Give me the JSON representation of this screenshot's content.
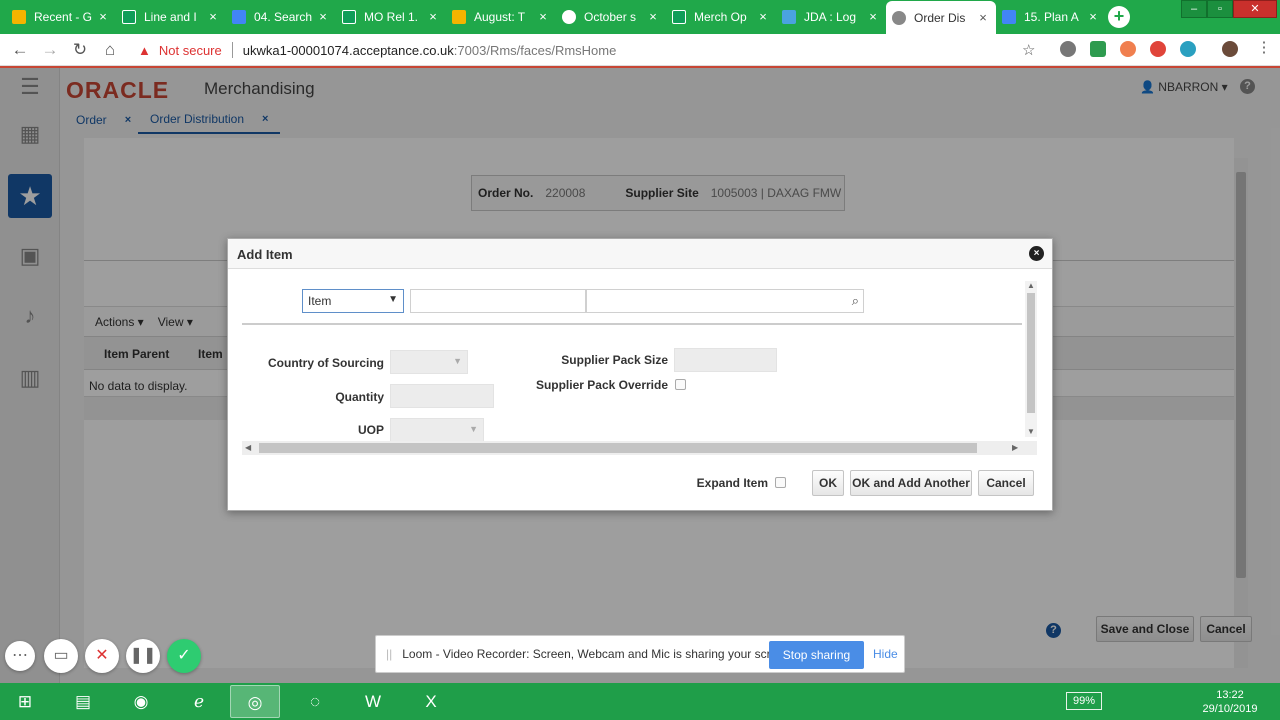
{
  "browser": {
    "tabs": [
      {
        "label": "Recent - G",
        "icon": "google-drive-icon",
        "color": "#f4b400"
      },
      {
        "label": "Line and I",
        "icon": "sheets-icon",
        "color": "#0f9d58"
      },
      {
        "label": "04. Search",
        "icon": "docs-icon",
        "color": "#4285f4"
      },
      {
        "label": "MO Rel 1.",
        "icon": "sheets-icon",
        "color": "#0f9d58"
      },
      {
        "label": "August: T",
        "icon": "slides-icon",
        "color": "#f4b400"
      },
      {
        "label": "October s",
        "icon": "globe-icon",
        "color": "#ffffff"
      },
      {
        "label": "Merch Op",
        "icon": "sheets-icon",
        "color": "#0f9d58"
      },
      {
        "label": "JDA : Log",
        "icon": "jda-icon",
        "color": "#4aa3df"
      },
      {
        "label": "Order Dis",
        "icon": "globe-icon",
        "color": "#888888"
      },
      {
        "label": "15. Plan A",
        "icon": "docs-icon",
        "color": "#4285f4"
      }
    ],
    "active_tab_index": 8,
    "not_secure": "Not secure",
    "url_host": "ukwka1-00001074.acceptance.co.uk",
    "url_path": ":7003/Rms/faces/RmsHome"
  },
  "app": {
    "logo": "ORACLE",
    "title": "Merchandising",
    "user": "NBARRON",
    "help": "?",
    "tabs": [
      {
        "label": "Order",
        "close": "×"
      },
      {
        "label": "Order Distribution",
        "close": "×"
      }
    ],
    "header": {
      "order_label": "Order No.",
      "order_value": "220008",
      "supplier_label": "Supplier Site",
      "supplier_value": "1005003 | DAXAG FMW"
    },
    "table_toolbar": {
      "actions": "Actions ▾",
      "view": "View ▾"
    },
    "table_columns": [
      "Item Parent",
      "Item"
    ],
    "no_data": "No data to display.",
    "footer_buttons": {
      "save_close": "Save and Close",
      "cancel": "Cancel"
    }
  },
  "modal": {
    "title": "Add Item",
    "close": "×",
    "item_type_value": "Item",
    "labels": {
      "country": "Country of Sourcing",
      "quantity": "Quantity",
      "uop": "UOP",
      "pack_size": "Supplier Pack Size",
      "pack_override": "Supplier Pack Override",
      "expand_item": "Expand Item"
    },
    "buttons": {
      "ok": "OK",
      "ok_add": "OK and Add Another",
      "cancel": "Cancel"
    }
  },
  "loom": {
    "message": "Loom - Video Recorder: Screen, Webcam and Mic is sharing your screen.",
    "stop": "Stop sharing",
    "hide": "Hide"
  },
  "taskbar": {
    "battery": "99%",
    "time": "13:22",
    "date": "29/10/2019"
  }
}
